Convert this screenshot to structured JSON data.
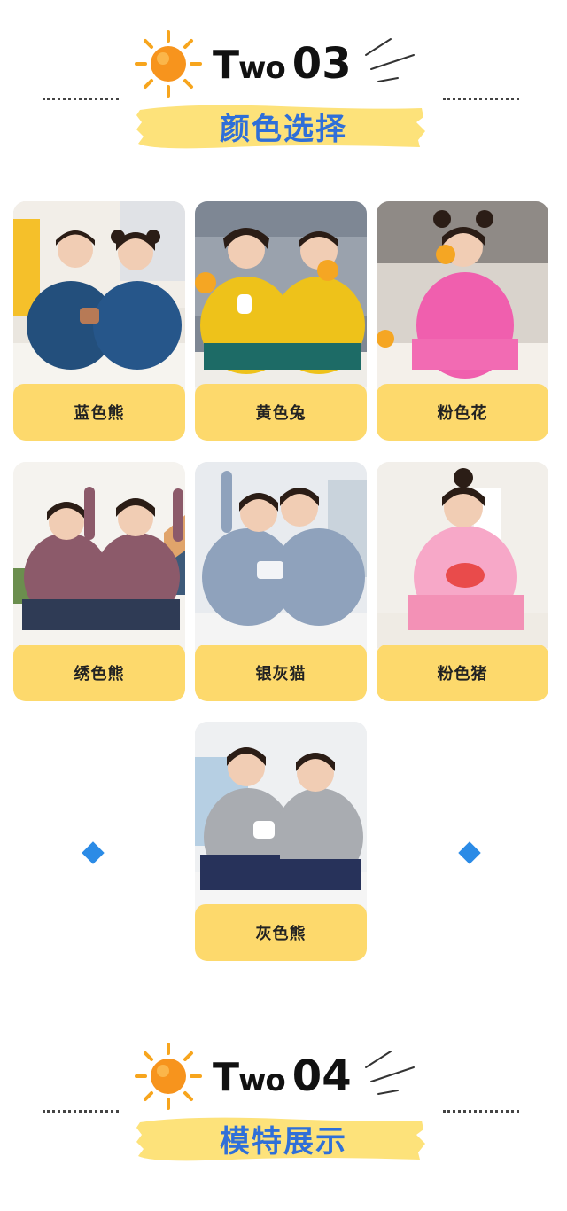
{
  "colors": {
    "accent_blue": "#2f6fd8",
    "label_yellow": "#fdd96c",
    "diamond_blue": "#2b8be6",
    "sun_orange": "#f7941d"
  },
  "sections": [
    {
      "title_word_big": "T",
      "title_word_small": "wo",
      "title_number": "03",
      "subtitle": "颜色选择"
    },
    {
      "title_word_big": "T",
      "title_word_small": "wo",
      "title_number": "04",
      "subtitle": "模特展示"
    }
  ],
  "products": [
    {
      "label": "蓝色熊"
    },
    {
      "label": "黄色兔"
    },
    {
      "label": "粉色花"
    },
    {
      "label": "绣色熊"
    },
    {
      "label": "银灰猫"
    },
    {
      "label": "粉色猪"
    },
    {
      "label": "灰色熊"
    }
  ],
  "icons": [
    "sun-icon",
    "speed-lines-icon",
    "diamond-icon"
  ]
}
